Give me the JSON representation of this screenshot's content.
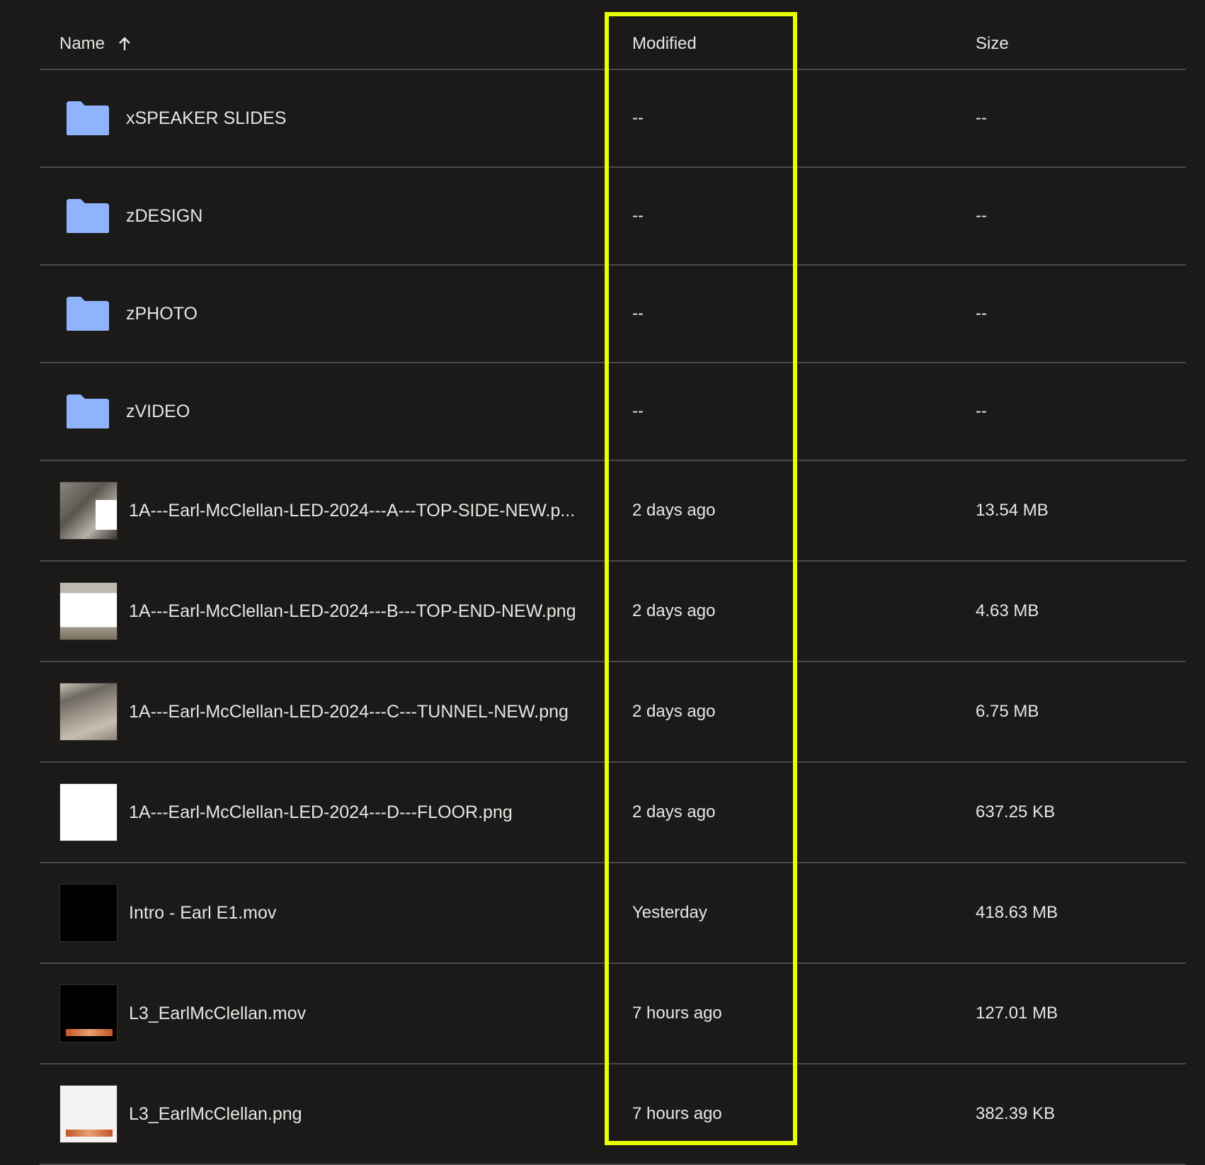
{
  "header": {
    "name_label": "Name",
    "modified_label": "Modified",
    "size_label": "Size"
  },
  "rows": [
    {
      "type": "folder",
      "name": "xSPEAKER SLIDES",
      "modified": "--",
      "size": "--"
    },
    {
      "type": "folder",
      "name": "zDESIGN",
      "modified": "--",
      "size": "--"
    },
    {
      "type": "folder",
      "name": "zPHOTO",
      "modified": "--",
      "size": "--"
    },
    {
      "type": "folder",
      "name": "zVIDEO",
      "modified": "--",
      "size": "--"
    },
    {
      "type": "file",
      "name": "1A---Earl-McClellan-LED-2024---A---TOP-SIDE-NEW.p...",
      "modified": "2 days ago",
      "size": "13.54 MB"
    },
    {
      "type": "file",
      "name": "1A---Earl-McClellan-LED-2024---B---TOP-END-NEW.png",
      "modified": "2 days ago",
      "size": "4.63 MB"
    },
    {
      "type": "file",
      "name": "1A---Earl-McClellan-LED-2024---C---TUNNEL-NEW.png",
      "modified": "2 days ago",
      "size": "6.75 MB"
    },
    {
      "type": "file",
      "name": "1A---Earl-McClellan-LED-2024---D---FLOOR.png",
      "modified": "2 days ago",
      "size": "637.25 KB"
    },
    {
      "type": "file",
      "name": "Intro - Earl E1.mov",
      "modified": "Yesterday",
      "size": "418.63 MB"
    },
    {
      "type": "file",
      "name": "L3_EarlMcClellan.mov",
      "modified": "7 hours ago",
      "size": "127.01 MB"
    },
    {
      "type": "file",
      "name": "L3_EarlMcClellan.png",
      "modified": "7 hours ago",
      "size": "382.39 KB"
    }
  ],
  "colors": {
    "background": "#1b1a19",
    "folder": "#8fb4fb",
    "highlight": "#e8ff00",
    "divider": "#4a4947"
  },
  "icons": {
    "sort": "arrow-up-icon",
    "folder": "folder-icon"
  }
}
